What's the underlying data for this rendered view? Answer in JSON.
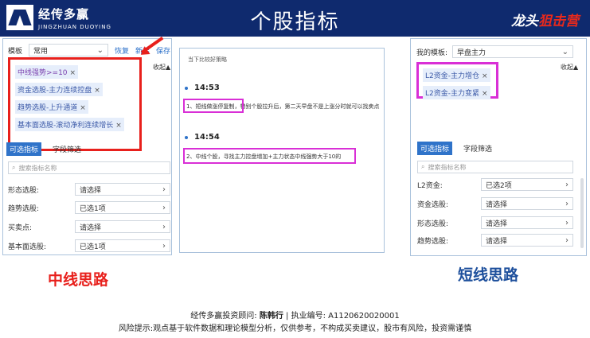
{
  "header": {
    "logo_cn": "经传多赢",
    "logo_en": "JINGZHUAN DUOYING",
    "title": "个股指标",
    "brand_a": "龙头",
    "brand_b": "狙击营"
  },
  "left": {
    "template_label": "模板",
    "template_value": "常用",
    "restore": "恢复",
    "new": "新建",
    "save": "保存",
    "collapse": "收起",
    "tags": [
      {
        "text": "中线强势>=10",
        "color": "purple"
      },
      {
        "text": "资金选股-主力连续控盘",
        "color": "blue"
      },
      {
        "text": "趋势选股-上升通道",
        "color": "blue"
      },
      {
        "text": "基本面选股-滚动净利连续增长",
        "color": "blue"
      }
    ],
    "tab_active": "可选指标",
    "tab_other": "字段筛选",
    "search_placeholder": "搜索指标名称",
    "filters": [
      {
        "label": "形态选股:",
        "value": "请选择"
      },
      {
        "label": "趋势选股:",
        "value": "已选1项"
      },
      {
        "label": "买卖点:",
        "value": "请选择"
      },
      {
        "label": "基本面选股:",
        "value": "已选1项"
      }
    ]
  },
  "middle": {
    "title": "当下比较好策略",
    "entries": [
      {
        "time": "14:53",
        "note": "1、短线做涨停复制，特别个股拉升后，第二天早盘不是上涨分时就可以找卖点"
      },
      {
        "time": "14:54",
        "note": "2、中线个股，寻找主力控盘增加+主力状态中线强势大于10的"
      }
    ]
  },
  "right": {
    "template_label": "我的模板:",
    "template_value": "早盘主力",
    "collapse": "收起",
    "tags": [
      {
        "text": "L2资金-主力增仓"
      },
      {
        "text": "L2资金-主力变紧"
      }
    ],
    "tab_active": "可选指标",
    "tab_other": "字段筛选",
    "search_placeholder": "搜索指标名称",
    "filters": [
      {
        "label": "L2资金:",
        "value": "已选2项"
      },
      {
        "label": "资金选股:",
        "value": "请选择"
      },
      {
        "label": "形态选股:",
        "value": "请选择"
      },
      {
        "label": "趋势选股:",
        "value": "请选择"
      }
    ]
  },
  "captions": {
    "left": "中线思路",
    "right": "短线思路"
  },
  "footer": {
    "line1_prefix": "经传多赢投资顾问: ",
    "advisor": "陈韩行",
    "line1_suffix": " | 执业编号: A1120620020001",
    "line2": "风险提示:观点基于软件数据和理论模型分析，仅供参考，不构成买卖建议，股市有风险，投资需谨慎"
  },
  "colors": {
    "header_bg": "#0f2a6e",
    "red_highlight": "#e8201c",
    "magenta_highlight": "#d92fd6",
    "accent_blue": "#2f73c9",
    "caption_blue": "#1d4f9c"
  }
}
